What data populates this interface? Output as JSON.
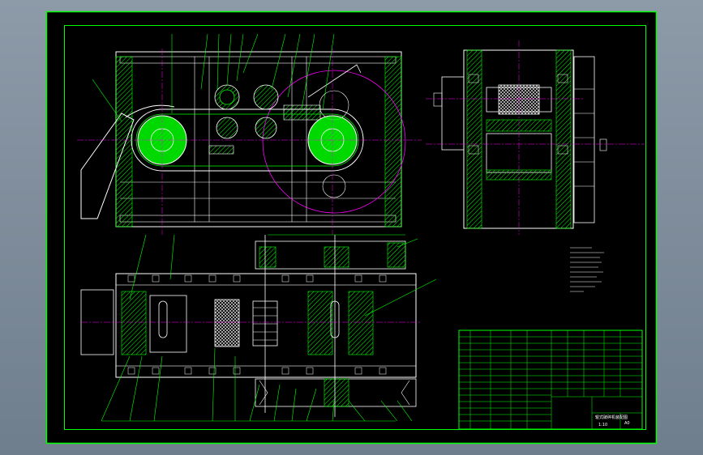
{
  "sheet": {
    "title_block_name": "辊式破碎机装配图",
    "title_block_code": "A0",
    "title_block_scale": "1:10"
  },
  "colors": {
    "background": "#000000",
    "frame": "#00ff00",
    "outline": "#ffffff",
    "centerline": "#ff00ff",
    "hatch": "#00ff00",
    "leader": "#00ff00"
  }
}
